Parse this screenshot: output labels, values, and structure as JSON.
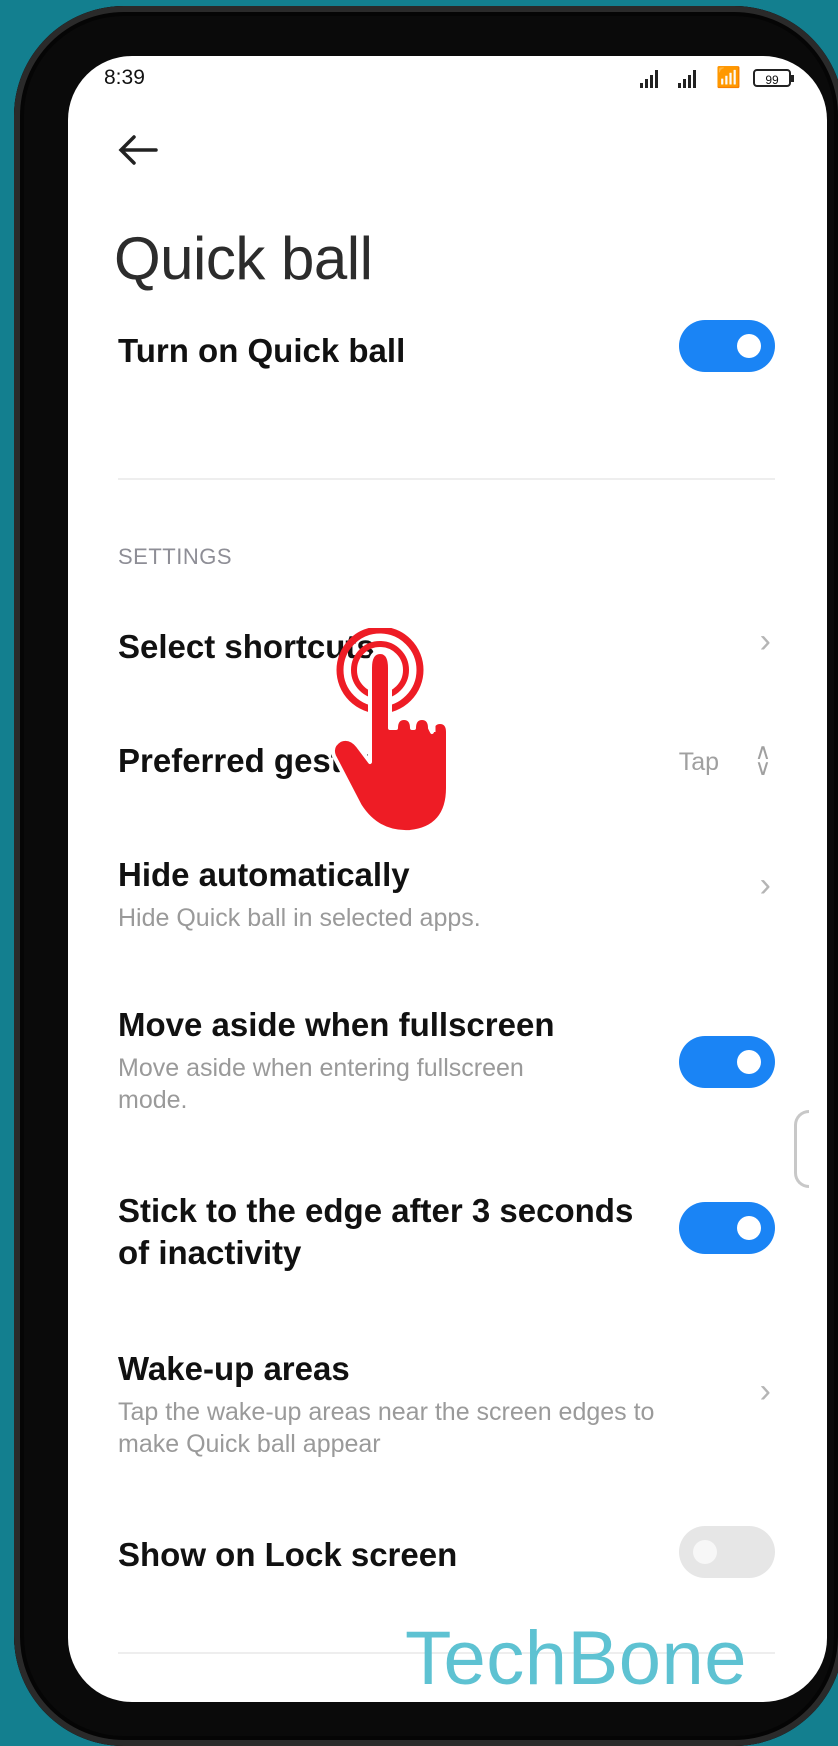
{
  "status_bar": {
    "time": "8:39",
    "battery": "99"
  },
  "page": {
    "title": "Quick ball"
  },
  "main_toggle": {
    "label": "Turn on Quick ball",
    "enabled": true
  },
  "settings": {
    "section_label": "SETTINGS",
    "select_shortcuts": {
      "label": "Select shortcuts"
    },
    "preferred_gesture": {
      "label": "Preferred gesture",
      "value": "Tap"
    },
    "hide_automatically": {
      "label": "Hide automatically",
      "description": "Hide Quick ball in selected apps."
    },
    "move_aside": {
      "label": "Move aside when fullscreen",
      "description": "Move aside when entering fullscreen mode.",
      "enabled": true
    },
    "stick_to_edge": {
      "label": "Stick to the edge after 3 seconds of inactivity",
      "enabled": true
    },
    "wake_up_areas": {
      "label": "Wake-up areas",
      "description": "Tap the wake-up areas near the screen edges to make Quick ball appear"
    },
    "show_on_lock_screen": {
      "label": "Show on Lock screen",
      "enabled": false
    }
  },
  "watermark": "TechBone",
  "colors": {
    "accent": "#1a84f5",
    "background": "#137f8f",
    "watermark": "#5ec2d2",
    "tap_hand": "#ee1c25"
  },
  "icons": {
    "back": "arrow-left-icon",
    "chevron": "chevron-right-icon",
    "updown": "chevron-up-down-icon",
    "hand": "tap-hand-icon"
  }
}
